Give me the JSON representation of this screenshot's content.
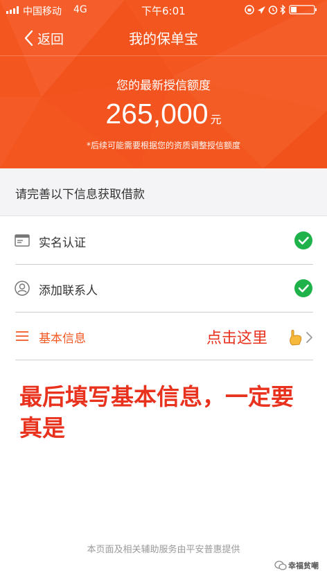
{
  "status_bar": {
    "carrier": "中国移动",
    "network": "4G",
    "time": "下午6:01"
  },
  "nav": {
    "back_label": "返回",
    "title": "我的保单宝"
  },
  "credit": {
    "label": "您的最新授信额度",
    "amount": "265,000",
    "unit": "元",
    "note": "*后续可能需要根据您的资质调整授信额度"
  },
  "section_header": "请完善以下信息获取借款",
  "items": [
    {
      "label": "实名认证",
      "icon": "id-card-icon",
      "completed": true
    },
    {
      "label": "添加联系人",
      "icon": "contact-icon",
      "completed": true
    },
    {
      "label": "基本信息",
      "icon": "menu-lines-icon",
      "completed": false
    }
  ],
  "annotations": {
    "click_here": "点击这里",
    "instruction": "最后填写基本信息，一定要真是"
  },
  "footer": "本页面及相关辅助服务由平安普惠提供",
  "watermark": "幸福贫嘲",
  "colors": {
    "brand_orange": "#f4561f",
    "check_green": "#1fb24a",
    "annotation_red": "#e8321e"
  }
}
